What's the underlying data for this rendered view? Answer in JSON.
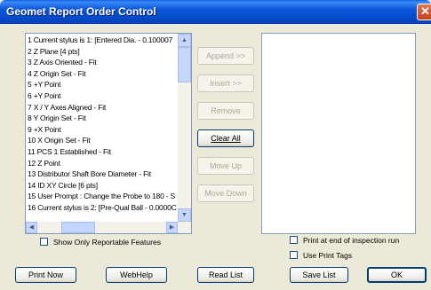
{
  "window": {
    "title": "Geomet Report Order Control",
    "close_glyph": "✕"
  },
  "list": {
    "items": [
      "1 Current stylus is 1: [Entered Dia. - 0.100007",
      "2 Z Plane [4 pts]",
      "3 Z Axis Oriented - Fit",
      "4 Z Origin Set - Fit",
      "5 +Y Point",
      "6 +Y Point",
      "7 X / Y Axes Aligned - Fit",
      "8 Y Origin Set - Fit",
      "9 +X Point",
      "10 X Origin Set - Fit",
      "11 PCS 1 Established - Fit",
      "12 Z Point",
      "13 Distributor Shaft Bore Diameter - Fit",
      "14 ID XY Circle [6 pts]",
      "15 User Prompt : Change the Probe to 180 - S",
      "16 Current stylus is 2: [Pre-Qual Ball - 0.0000C"
    ]
  },
  "buttons": {
    "append": "Append >>",
    "insert": "Insert >>",
    "remove": "Remove",
    "clear_all": "Clear All",
    "move_up": "Move Up",
    "move_down": "Move Down",
    "print_now": "Print Now",
    "webhelp": "WebHelp",
    "read_list": "Read List",
    "save_list": "Save List",
    "ok": "OK"
  },
  "checkboxes": {
    "show_only_reportable": {
      "label": "Show Only Reportable Features",
      "checked": false
    },
    "print_at_end": {
      "label": "Print at end of inspection run",
      "checked": false
    },
    "use_print_tags": {
      "label": "Use Print Tags",
      "checked": false
    }
  },
  "scroll_glyphs": {
    "up": "▲",
    "down": "▼",
    "left": "◀",
    "right": "▶"
  }
}
